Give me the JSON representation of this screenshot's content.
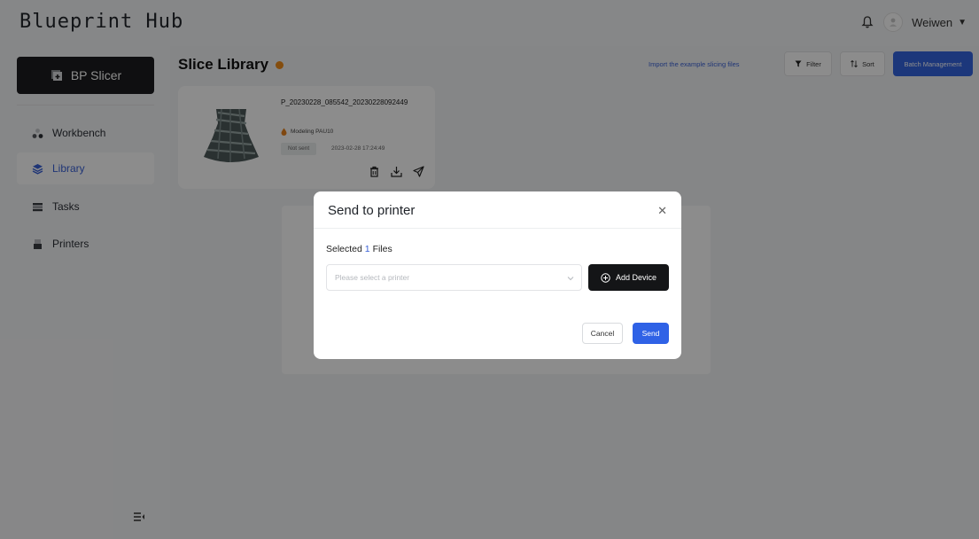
{
  "app": {
    "title": "Blueprint Hub"
  },
  "header": {
    "user_name": "Weiwen"
  },
  "sidebar": {
    "slicer_label": "BP Slicer",
    "items": [
      {
        "label": "Workbench",
        "icon": "workbench-icon"
      },
      {
        "label": "Library",
        "icon": "library-icon",
        "active": true
      },
      {
        "label": "Tasks",
        "icon": "tasks-icon"
      },
      {
        "label": "Printers",
        "icon": "printer-icon"
      }
    ]
  },
  "main": {
    "title": "Slice Library",
    "import_link": "Import the example slicing files",
    "filter_label": "Filter",
    "sort_label": "Sort",
    "batch_label": "Batch Management"
  },
  "file_card": {
    "name": "P_20230228_085542_20230228092449",
    "material": "Modeling PAU10",
    "status": "Not sent",
    "timestamp": "2023-02-28 17:24:49"
  },
  "modal": {
    "title": "Send to printer",
    "selected_prefix": "Selected",
    "selected_count": "1",
    "selected_suffix": "Files",
    "printer_placeholder": "Please select a printer",
    "add_device_label": "Add Device",
    "cancel_label": "Cancel",
    "send_label": "Send"
  },
  "colors": {
    "accent": "#3464e0",
    "dark_button": "#141517",
    "info_dot": "#f08c1a"
  }
}
